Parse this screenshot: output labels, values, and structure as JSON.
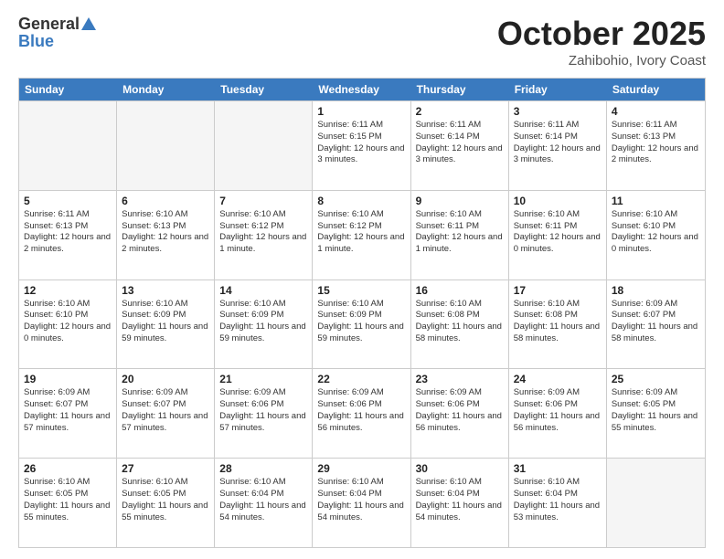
{
  "header": {
    "logo_general": "General",
    "logo_blue": "Blue",
    "title": "October 2025",
    "location": "Zahibohio, Ivory Coast"
  },
  "weekdays": [
    "Sunday",
    "Monday",
    "Tuesday",
    "Wednesday",
    "Thursday",
    "Friday",
    "Saturday"
  ],
  "rows": [
    [
      {
        "day": "",
        "info": ""
      },
      {
        "day": "",
        "info": ""
      },
      {
        "day": "",
        "info": ""
      },
      {
        "day": "1",
        "info": "Sunrise: 6:11 AM\nSunset: 6:15 PM\nDaylight: 12 hours\nand 3 minutes."
      },
      {
        "day": "2",
        "info": "Sunrise: 6:11 AM\nSunset: 6:14 PM\nDaylight: 12 hours\nand 3 minutes."
      },
      {
        "day": "3",
        "info": "Sunrise: 6:11 AM\nSunset: 6:14 PM\nDaylight: 12 hours\nand 3 minutes."
      },
      {
        "day": "4",
        "info": "Sunrise: 6:11 AM\nSunset: 6:13 PM\nDaylight: 12 hours\nand 2 minutes."
      }
    ],
    [
      {
        "day": "5",
        "info": "Sunrise: 6:11 AM\nSunset: 6:13 PM\nDaylight: 12 hours\nand 2 minutes."
      },
      {
        "day": "6",
        "info": "Sunrise: 6:10 AM\nSunset: 6:13 PM\nDaylight: 12 hours\nand 2 minutes."
      },
      {
        "day": "7",
        "info": "Sunrise: 6:10 AM\nSunset: 6:12 PM\nDaylight: 12 hours\nand 1 minute."
      },
      {
        "day": "8",
        "info": "Sunrise: 6:10 AM\nSunset: 6:12 PM\nDaylight: 12 hours\nand 1 minute."
      },
      {
        "day": "9",
        "info": "Sunrise: 6:10 AM\nSunset: 6:11 PM\nDaylight: 12 hours\nand 1 minute."
      },
      {
        "day": "10",
        "info": "Sunrise: 6:10 AM\nSunset: 6:11 PM\nDaylight: 12 hours\nand 0 minutes."
      },
      {
        "day": "11",
        "info": "Sunrise: 6:10 AM\nSunset: 6:10 PM\nDaylight: 12 hours\nand 0 minutes."
      }
    ],
    [
      {
        "day": "12",
        "info": "Sunrise: 6:10 AM\nSunset: 6:10 PM\nDaylight: 12 hours\nand 0 minutes."
      },
      {
        "day": "13",
        "info": "Sunrise: 6:10 AM\nSunset: 6:09 PM\nDaylight: 11 hours\nand 59 minutes."
      },
      {
        "day": "14",
        "info": "Sunrise: 6:10 AM\nSunset: 6:09 PM\nDaylight: 11 hours\nand 59 minutes."
      },
      {
        "day": "15",
        "info": "Sunrise: 6:10 AM\nSunset: 6:09 PM\nDaylight: 11 hours\nand 59 minutes."
      },
      {
        "day": "16",
        "info": "Sunrise: 6:10 AM\nSunset: 6:08 PM\nDaylight: 11 hours\nand 58 minutes."
      },
      {
        "day": "17",
        "info": "Sunrise: 6:10 AM\nSunset: 6:08 PM\nDaylight: 11 hours\nand 58 minutes."
      },
      {
        "day": "18",
        "info": "Sunrise: 6:09 AM\nSunset: 6:07 PM\nDaylight: 11 hours\nand 58 minutes."
      }
    ],
    [
      {
        "day": "19",
        "info": "Sunrise: 6:09 AM\nSunset: 6:07 PM\nDaylight: 11 hours\nand 57 minutes."
      },
      {
        "day": "20",
        "info": "Sunrise: 6:09 AM\nSunset: 6:07 PM\nDaylight: 11 hours\nand 57 minutes."
      },
      {
        "day": "21",
        "info": "Sunrise: 6:09 AM\nSunset: 6:06 PM\nDaylight: 11 hours\nand 57 minutes."
      },
      {
        "day": "22",
        "info": "Sunrise: 6:09 AM\nSunset: 6:06 PM\nDaylight: 11 hours\nand 56 minutes."
      },
      {
        "day": "23",
        "info": "Sunrise: 6:09 AM\nSunset: 6:06 PM\nDaylight: 11 hours\nand 56 minutes."
      },
      {
        "day": "24",
        "info": "Sunrise: 6:09 AM\nSunset: 6:06 PM\nDaylight: 11 hours\nand 56 minutes."
      },
      {
        "day": "25",
        "info": "Sunrise: 6:09 AM\nSunset: 6:05 PM\nDaylight: 11 hours\nand 55 minutes."
      }
    ],
    [
      {
        "day": "26",
        "info": "Sunrise: 6:10 AM\nSunset: 6:05 PM\nDaylight: 11 hours\nand 55 minutes."
      },
      {
        "day": "27",
        "info": "Sunrise: 6:10 AM\nSunset: 6:05 PM\nDaylight: 11 hours\nand 55 minutes."
      },
      {
        "day": "28",
        "info": "Sunrise: 6:10 AM\nSunset: 6:04 PM\nDaylight: 11 hours\nand 54 minutes."
      },
      {
        "day": "29",
        "info": "Sunrise: 6:10 AM\nSunset: 6:04 PM\nDaylight: 11 hours\nand 54 minutes."
      },
      {
        "day": "30",
        "info": "Sunrise: 6:10 AM\nSunset: 6:04 PM\nDaylight: 11 hours\nand 54 minutes."
      },
      {
        "day": "31",
        "info": "Sunrise: 6:10 AM\nSunset: 6:04 PM\nDaylight: 11 hours\nand 53 minutes."
      },
      {
        "day": "",
        "info": ""
      }
    ]
  ]
}
